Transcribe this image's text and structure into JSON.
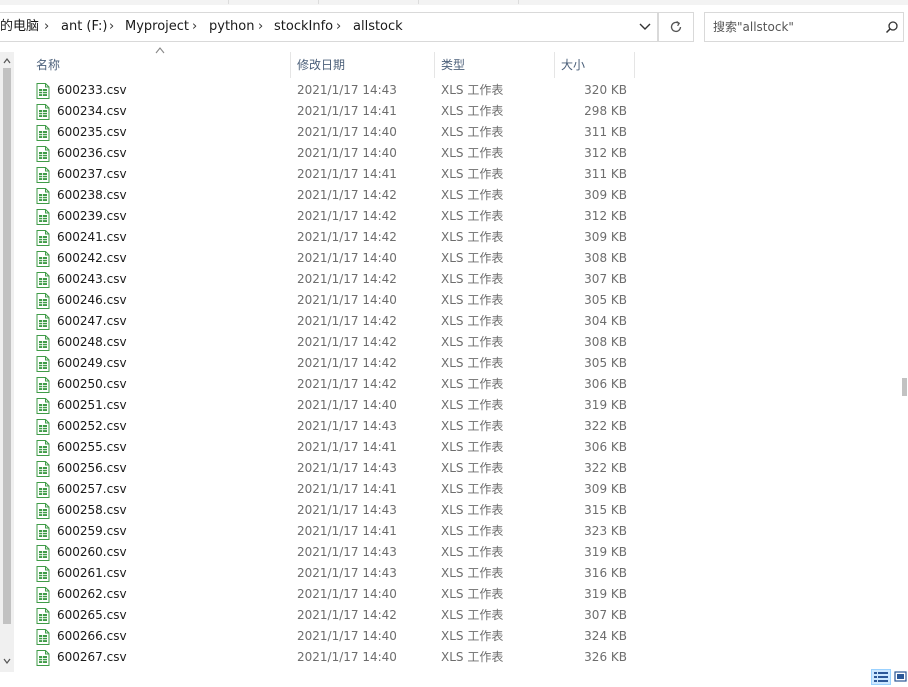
{
  "breadcrumb": {
    "items": [
      "的电脑",
      "ant (F:)",
      "Myproject",
      "python",
      "stockInfo",
      "allstock"
    ],
    "separator": "›"
  },
  "search": {
    "placeholder": "搜索\"allstock\""
  },
  "columns": {
    "name": "名称",
    "date": "修改日期",
    "type": "类型",
    "size": "大小"
  },
  "files": [
    {
      "name": "600233.csv",
      "date": "2021/1/17 14:43",
      "type": "XLS 工作表",
      "size": "320 KB"
    },
    {
      "name": "600234.csv",
      "date": "2021/1/17 14:41",
      "type": "XLS 工作表",
      "size": "298 KB"
    },
    {
      "name": "600235.csv",
      "date": "2021/1/17 14:40",
      "type": "XLS 工作表",
      "size": "311 KB"
    },
    {
      "name": "600236.csv",
      "date": "2021/1/17 14:40",
      "type": "XLS 工作表",
      "size": "312 KB"
    },
    {
      "name": "600237.csv",
      "date": "2021/1/17 14:41",
      "type": "XLS 工作表",
      "size": "311 KB"
    },
    {
      "name": "600238.csv",
      "date": "2021/1/17 14:42",
      "type": "XLS 工作表",
      "size": "309 KB"
    },
    {
      "name": "600239.csv",
      "date": "2021/1/17 14:42",
      "type": "XLS 工作表",
      "size": "312 KB"
    },
    {
      "name": "600241.csv",
      "date": "2021/1/17 14:42",
      "type": "XLS 工作表",
      "size": "309 KB"
    },
    {
      "name": "600242.csv",
      "date": "2021/1/17 14:40",
      "type": "XLS 工作表",
      "size": "308 KB"
    },
    {
      "name": "600243.csv",
      "date": "2021/1/17 14:42",
      "type": "XLS 工作表",
      "size": "307 KB"
    },
    {
      "name": "600246.csv",
      "date": "2021/1/17 14:40",
      "type": "XLS 工作表",
      "size": "305 KB"
    },
    {
      "name": "600247.csv",
      "date": "2021/1/17 14:42",
      "type": "XLS 工作表",
      "size": "304 KB"
    },
    {
      "name": "600248.csv",
      "date": "2021/1/17 14:42",
      "type": "XLS 工作表",
      "size": "308 KB"
    },
    {
      "name": "600249.csv",
      "date": "2021/1/17 14:42",
      "type": "XLS 工作表",
      "size": "305 KB"
    },
    {
      "name": "600250.csv",
      "date": "2021/1/17 14:42",
      "type": "XLS 工作表",
      "size": "306 KB"
    },
    {
      "name": "600251.csv",
      "date": "2021/1/17 14:40",
      "type": "XLS 工作表",
      "size": "319 KB"
    },
    {
      "name": "600252.csv",
      "date": "2021/1/17 14:43",
      "type": "XLS 工作表",
      "size": "322 KB"
    },
    {
      "name": "600255.csv",
      "date": "2021/1/17 14:41",
      "type": "XLS 工作表",
      "size": "306 KB"
    },
    {
      "name": "600256.csv",
      "date": "2021/1/17 14:43",
      "type": "XLS 工作表",
      "size": "322 KB"
    },
    {
      "name": "600257.csv",
      "date": "2021/1/17 14:41",
      "type": "XLS 工作表",
      "size": "309 KB"
    },
    {
      "name": "600258.csv",
      "date": "2021/1/17 14:43",
      "type": "XLS 工作表",
      "size": "315 KB"
    },
    {
      "name": "600259.csv",
      "date": "2021/1/17 14:41",
      "type": "XLS 工作表",
      "size": "323 KB"
    },
    {
      "name": "600260.csv",
      "date": "2021/1/17 14:43",
      "type": "XLS 工作表",
      "size": "319 KB"
    },
    {
      "name": "600261.csv",
      "date": "2021/1/17 14:43",
      "type": "XLS 工作表",
      "size": "316 KB"
    },
    {
      "name": "600262.csv",
      "date": "2021/1/17 14:40",
      "type": "XLS 工作表",
      "size": "319 KB"
    },
    {
      "name": "600265.csv",
      "date": "2021/1/17 14:42",
      "type": "XLS 工作表",
      "size": "307 KB"
    },
    {
      "name": "600266.csv",
      "date": "2021/1/17 14:40",
      "type": "XLS 工作表",
      "size": "324 KB"
    },
    {
      "name": "600267.csv",
      "date": "2021/1/17 14:40",
      "type": "XLS 工作表",
      "size": "326 KB"
    }
  ],
  "icons": {
    "file": "csv-file-icon",
    "dropdown": "chevron-down-icon",
    "refresh": "refresh-icon",
    "search": "search-icon",
    "sort": "sort-up-icon",
    "view_details": "details-view-icon",
    "view_large": "large-icons-view-icon"
  },
  "colors": {
    "header_text": "#4c607a",
    "file_icon_green": "#3f9b47",
    "meta_text": "#6d6d6d",
    "selected_view": "#cce8ff"
  }
}
